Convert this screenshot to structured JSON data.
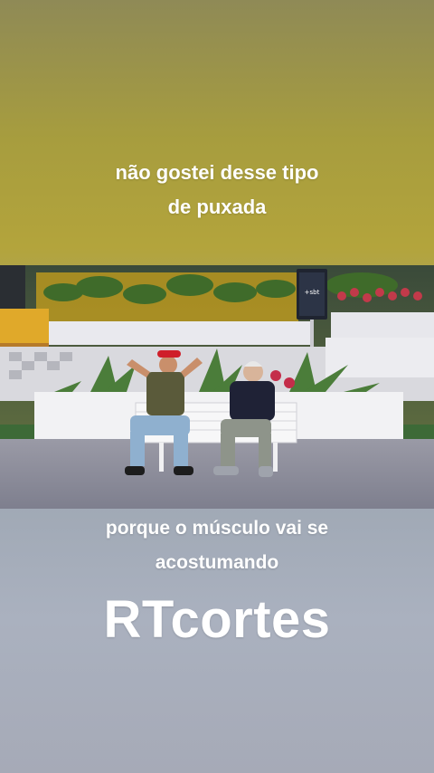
{
  "captions": {
    "top_line1": "não gostei desse tipo",
    "top_line2": "de puxada",
    "bottom_line1": "porque o músculo vai se",
    "bottom_line2": "acostumando"
  },
  "watermark": "RTcortes",
  "tv_logo": "+sbt",
  "colors": {
    "caption_text": "#ffffff",
    "top_band": "#b3a43c",
    "bottom_band": "#a6aab7"
  }
}
